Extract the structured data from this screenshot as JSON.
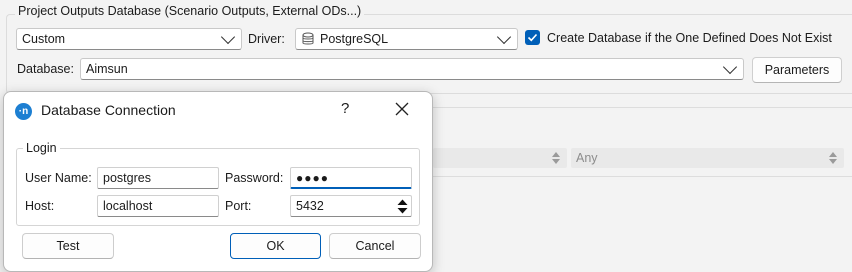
{
  "project_outputs": {
    "group_title": "Project Outputs Database (Scenario Outputs, External ODs...)",
    "type_value": "Custom",
    "driver_label": "Driver:",
    "driver_value": "PostgreSQL",
    "driver_icon": "database-icon",
    "create_db_checked": true,
    "create_db_label": "Create Database if the One Defined Does Not Exist",
    "database_label": "Database:",
    "database_value": "Aimsun",
    "parameters_label": "Parameters",
    "disabled_spin_value": "Any"
  },
  "dialog": {
    "title": "Database Connection",
    "app_icon_text": "·n",
    "help_label": "?",
    "login_group": "Login",
    "user_name_label": "User Name:",
    "user_name_value": "postgres",
    "password_label": "Password:",
    "password_masked": "●●●●",
    "host_label": "Host:",
    "host_value": "localhost",
    "port_label": "Port:",
    "port_value": "5432",
    "test_label": "Test",
    "ok_label": "OK",
    "cancel_label": "Cancel"
  },
  "colors": {
    "accent": "#005fb8",
    "app_icon": "#1d7fd2",
    "window_bg": "#f3f3f3",
    "dialog_bg": "#ffffff"
  }
}
